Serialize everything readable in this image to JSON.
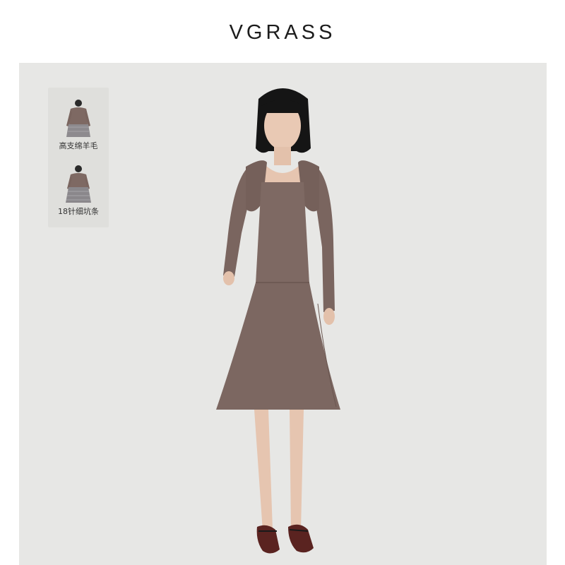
{
  "brand": {
    "name": "VGRASS"
  },
  "thumbnails": [
    {
      "label": "高支绵羊毛",
      "icon": "sweater-with-tulle-skirt-thumbnail"
    },
    {
      "label": "18针细坑条",
      "icon": "sweater-with-tulle-skirt-thumbnail"
    }
  ],
  "product": {
    "image": "model-in-mauve-knit-dress-with-shrug",
    "colors": {
      "knit": "#7e6963",
      "background": "#e7e7e5",
      "shoes": "#5a2320"
    }
  }
}
